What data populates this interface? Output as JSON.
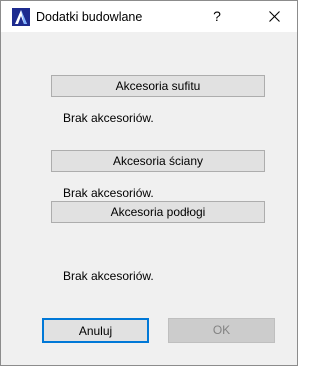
{
  "window": {
    "title": "Dodatki budowlane",
    "help_label": "?",
    "app_icon": "archicad-logo-icon"
  },
  "sections": [
    {
      "button_label": "Akcesoria sufitu",
      "status": "Brak akcesoriów."
    },
    {
      "button_label": "Akcesoria ściany",
      "status": "Brak akcesoriów."
    },
    {
      "button_label": "Akcesoria podłogi",
      "status": "Brak akcesoriów."
    }
  ],
  "buttons": {
    "cancel_label": "Anuluj",
    "ok_label": "OK"
  },
  "colors": {
    "dialog_bg": "#f0f0f0",
    "focus_border": "#0078d7",
    "disabled_text": "#838383"
  }
}
